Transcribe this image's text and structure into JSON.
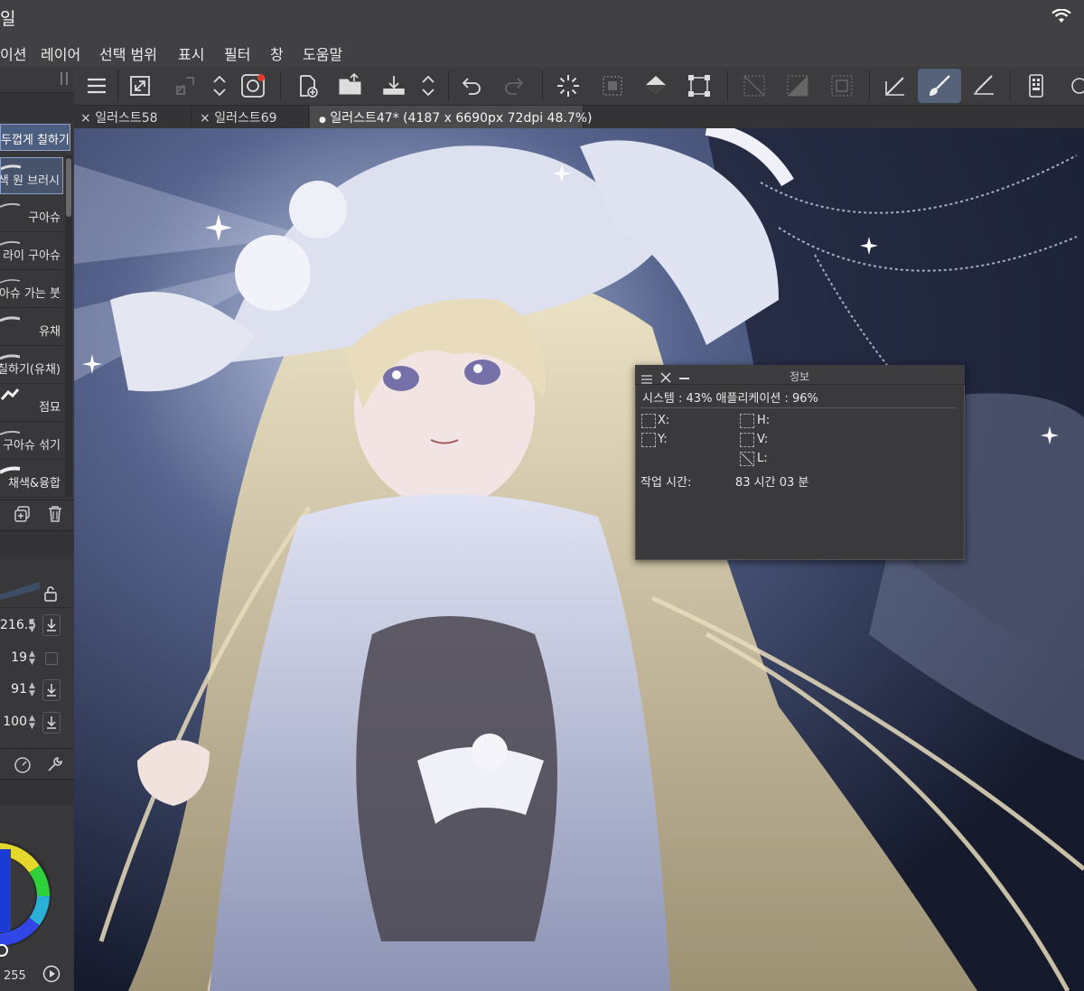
{
  "app": {
    "title": "일",
    "wifi_icon": "wifi-icon"
  },
  "menu": [
    "이션",
    "레이어",
    "선택 범위",
    "표시",
    "필터",
    "창",
    "도움말"
  ],
  "subtool_panel": {
    "active_label": "두껍게 칠하기",
    "brushes": [
      {
        "label": "색 원 브러시",
        "selected": true
      },
      {
        "label": "구아슈"
      },
      {
        "label": "라이 구아슈"
      },
      {
        "label": "아슈 가는 붓"
      },
      {
        "label": "유채"
      },
      {
        "label": "칠하기(유채)"
      },
      {
        "label": "점묘"
      },
      {
        "label": "구아슈 섞기"
      },
      {
        "label": "채색&융합"
      }
    ]
  },
  "tool_properties": {
    "brush_size": "216.5",
    "value_2": "19",
    "value_3": "91",
    "value_4": "100"
  },
  "color": {
    "value": "255"
  },
  "tabs": [
    {
      "label": "일러스트58",
      "close": "×"
    },
    {
      "label": "일러스트69",
      "close": "×"
    },
    {
      "label": "일러스트47* (4187 x 6690px 72dpi 48.7%)",
      "active": true,
      "dot": "●"
    }
  ],
  "info_panel": {
    "title": "정보",
    "memory_line": "시스템 : 43%   애플리케이션 : 96%",
    "x_label": "X:",
    "y_label": "Y:",
    "h_label": "H:",
    "v_label": "V:",
    "l_label": "L:",
    "work_time_label": "작업 시간:",
    "work_time_value": "83 시간 03 분"
  },
  "colors": {
    "accent": "#55627a",
    "selection": "#4c5f80",
    "panel": "#38383a"
  }
}
